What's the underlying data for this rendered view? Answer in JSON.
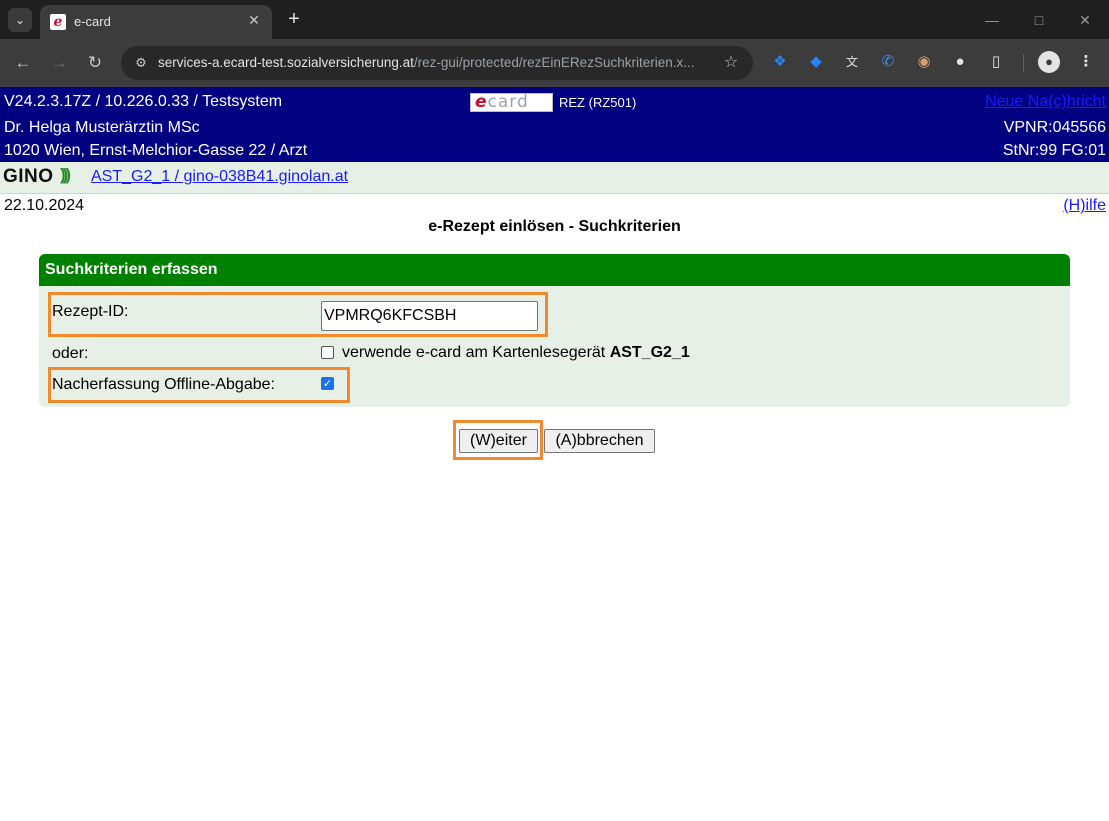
{
  "browser": {
    "tab_title": "e-card",
    "tab_favicon_letter": "e",
    "url_host": "services-a.ecard-test.sozialversicherung.at",
    "url_path": "/rez-gui/protected/rezEinERezSuchkriterien.x...",
    "icons": {
      "tab_search": "chevron-down-icon",
      "close_tab": "close-icon",
      "new_tab": "plus-icon",
      "back": "arrow-left-icon",
      "forward": "arrow-right-icon",
      "reload": "reload-icon",
      "site_info": "tune-icon",
      "bookmark": "star-icon",
      "extensions": [
        "jira-icon",
        "diamond-icon",
        "translate-icon",
        "phone-icon",
        "owl-icon",
        "ghost-icon",
        "puzzle-icon"
      ],
      "profile": "person-icon",
      "menu": "kebab-menu-icon"
    }
  },
  "header": {
    "version": "V24.2.3.17Z / 10.226.0.33  / Testsystem",
    "doctor": "Dr. Helga Musterärztin MSc",
    "address": "1020 Wien, Ernst-Melchior-Gasse 22 / Arzt",
    "logo_e": "e",
    "logo_rest": "card",
    "system": "REZ (RZ501)",
    "message_link": "Neue Na(c)hricht",
    "vpnr": "VPNR:045566",
    "stnr": "StNr:99 FG:01"
  },
  "gino": {
    "logo": "GINO",
    "connection": "AST_G2_1 / gino-038B41.ginolan.at"
  },
  "page": {
    "date": "22.10.2024",
    "help": "(H)ilfe",
    "title": "e-Rezept einlösen - Suchkriterien"
  },
  "form": {
    "section_title": "Suchkriterien erfassen",
    "rezept_label": "Rezept-ID:",
    "rezept_value": "VPMRQ6KFCSBH",
    "oder_label": "oder:",
    "ecard_option_text": "verwende e-card am Kartenlesegerät ",
    "reader_name": "AST_G2_1",
    "ecard_checked": false,
    "offline_label": "Nacherfassung Offline-Abgabe:",
    "offline_checked": true
  },
  "buttons": {
    "weiter": "(W)eiter",
    "abbrechen": "(A)bbrechen"
  },
  "colors": {
    "header_bg": "#000080",
    "section_green": "#008000",
    "panel_bg": "#e6f0e6",
    "highlight": "#f08a2c",
    "link": "#1a1aff"
  }
}
